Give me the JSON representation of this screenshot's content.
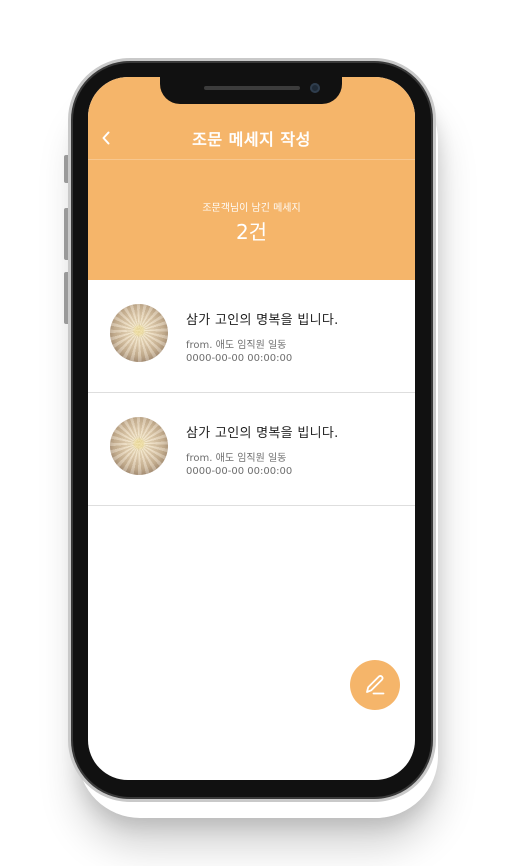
{
  "header": {
    "back_icon": "chevron-left-icon",
    "title": "조문 메세지 작성",
    "count_caption": "조문객님이 남긴 메세지",
    "count_value": "2건",
    "accent_color": "#f5b56a"
  },
  "messages": [
    {
      "avatar": "chrysanthemum-photo",
      "title": "삼가 고인의 명복을 빕니다.",
      "from": "from. 애도 임직원 일동",
      "date": "0000-00-00 00:00:00"
    },
    {
      "avatar": "chrysanthemum-photo",
      "title": "삼가 고인의 명복을 빕니다.",
      "from": "from. 애도 임직원 일동",
      "date": "0000-00-00 00:00:00"
    }
  ],
  "fab": {
    "icon": "pencil-icon"
  }
}
